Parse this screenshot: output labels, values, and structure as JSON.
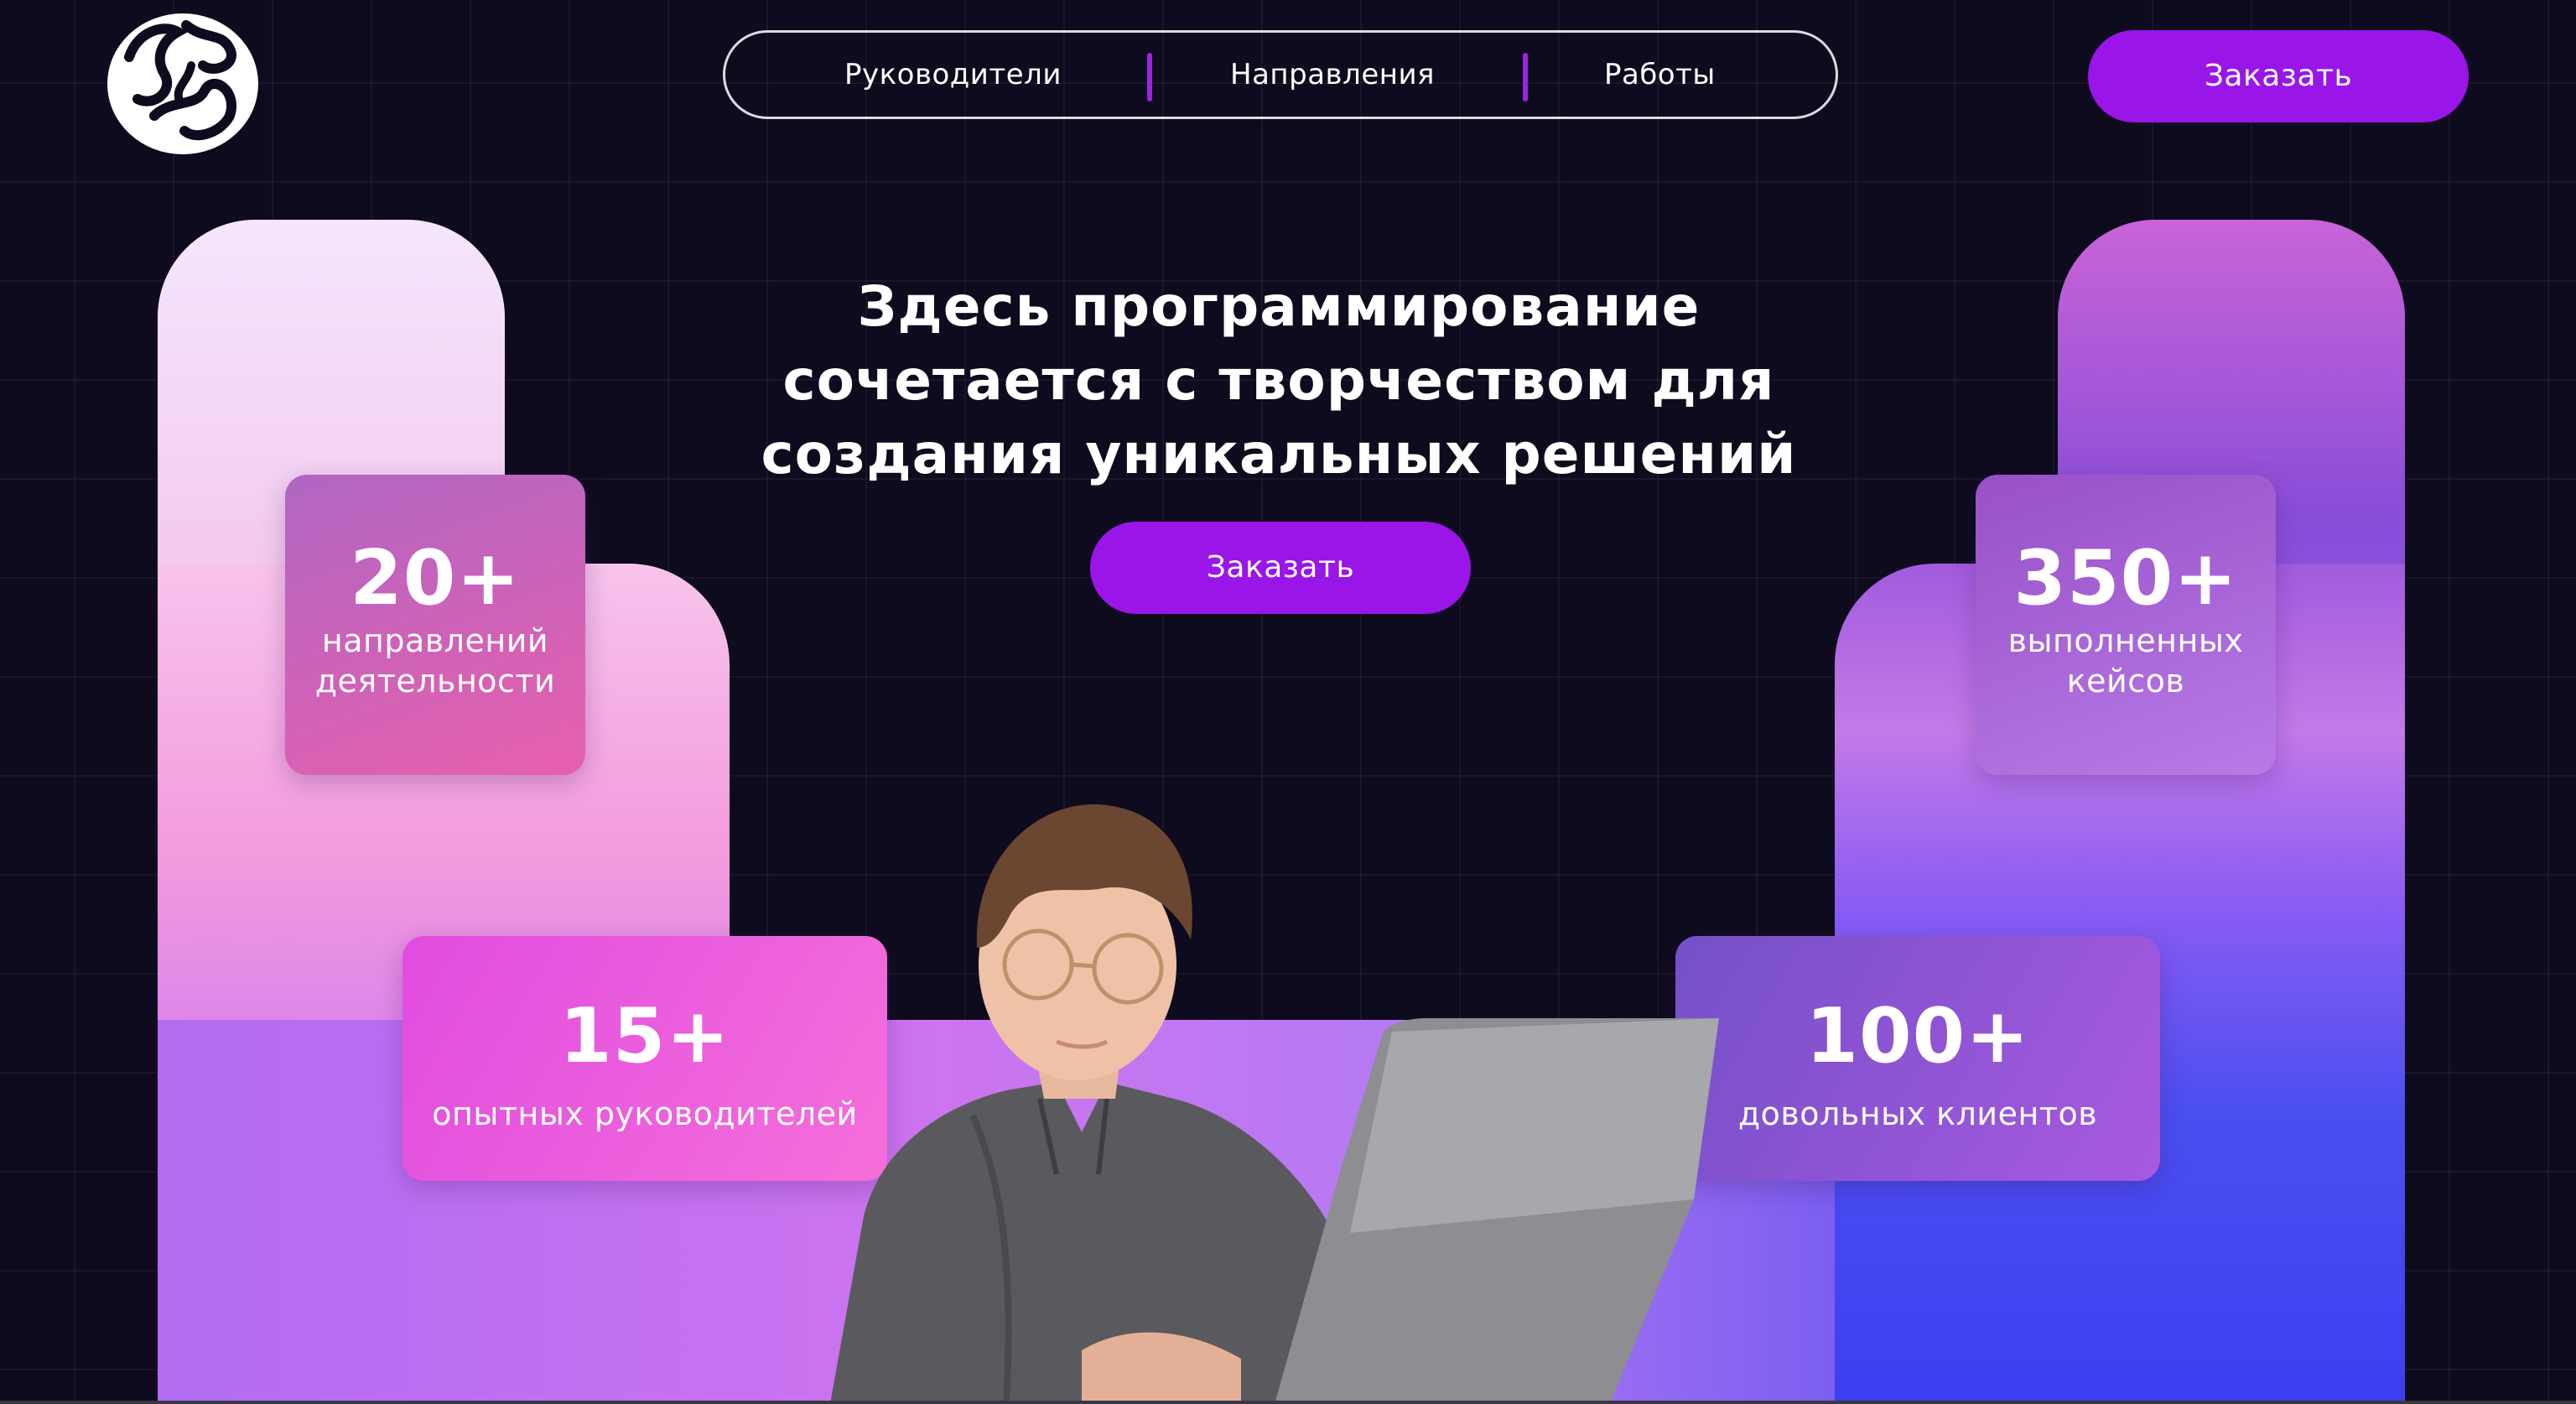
{
  "logo": {
    "icon": "brand-logo-icon"
  },
  "nav": {
    "items": [
      {
        "label": "Руководители"
      },
      {
        "label": "Направления"
      },
      {
        "label": "Работы"
      }
    ],
    "separator_color": "#9b24e0"
  },
  "header_button": {
    "label": "Заказать"
  },
  "hero": {
    "headline_lines": [
      "Здесь программирование",
      "сочетается с творчеством для",
      "создания уникальных решений"
    ],
    "cta_label": "Заказать"
  },
  "stats": [
    {
      "value": "20+",
      "label_lines": [
        "направлений",
        "деятельности"
      ]
    },
    {
      "value": "15+",
      "label_lines": [
        "опытных руководителей"
      ]
    },
    {
      "value": "350+",
      "label_lines": [
        "выполненных",
        "кейсов"
      ]
    },
    {
      "value": "100+",
      "label_lines": [
        "довольных клиентов"
      ]
    }
  ],
  "colors": {
    "background": "#0e0b1e",
    "accent": "#9a15e8"
  },
  "hero_image": {
    "icon": "student-with-laptop-illustration"
  }
}
